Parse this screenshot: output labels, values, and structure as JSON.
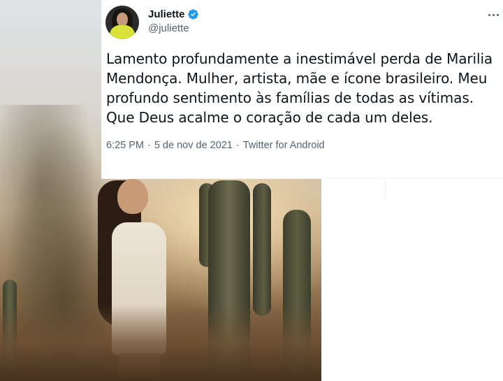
{
  "tweet": {
    "display_name": "Juliette",
    "handle": "@juliette",
    "verified": true,
    "text": "Lamento profundamente a inestimável perda de Marilia\nMendonça. Mulher, artista, mãe e ícone brasileiro. Meu\nprofundo sentimento às famílias de todas as vítimas.\nQue Deus acalme o coração de cada um deles.",
    "time": "6:25 PM",
    "date": "5 de nov de 2021",
    "separator": "·",
    "source": "Twitter for Android"
  },
  "colors": {
    "text_primary": "#0f1419",
    "text_secondary": "#536471",
    "verified_blue": "#1d9bf0",
    "avatar_outfit": "#d8e23a"
  },
  "icons": {
    "more": "more-horizontal-icon",
    "verified": "verified-badge-icon"
  }
}
